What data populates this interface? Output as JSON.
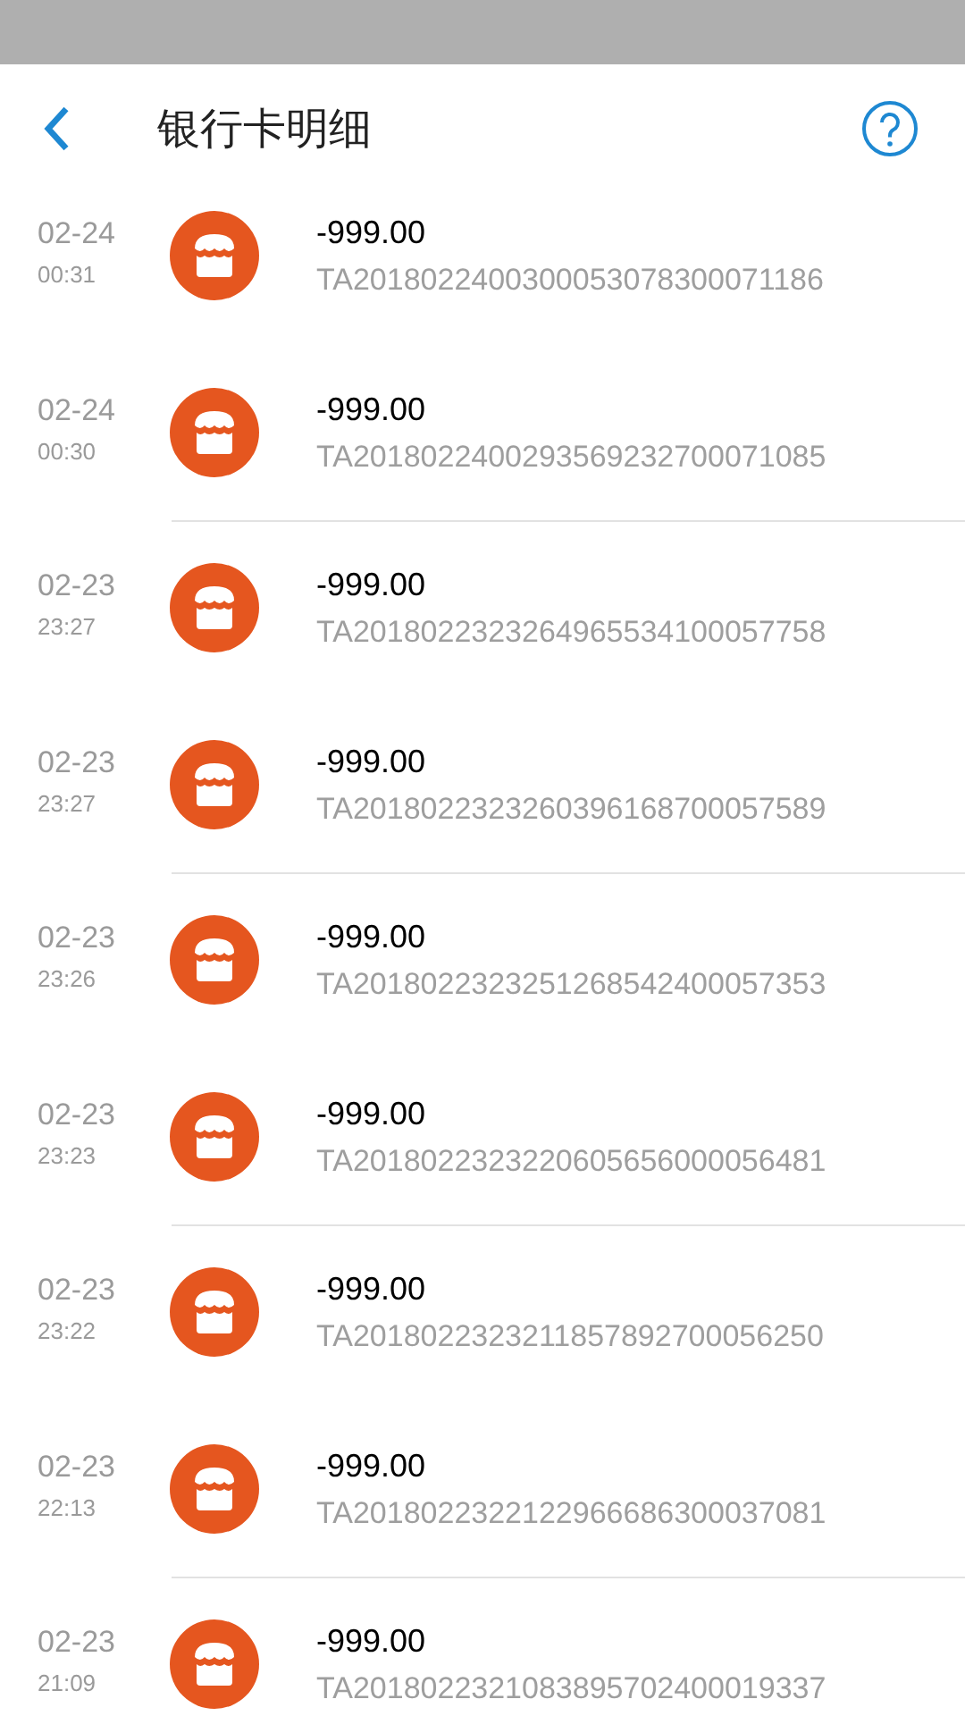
{
  "header": {
    "title": "银行卡明细"
  },
  "transactions": [
    {
      "date": "02-24",
      "time": "00:31",
      "amount": "-999.00",
      "reference": "TA2018022400300053078300071186"
    },
    {
      "date": "02-24",
      "time": "00:30",
      "amount": "-999.00",
      "reference": "TA2018022400293569232700071085"
    },
    {
      "date": "02-23",
      "time": "23:27",
      "amount": "-999.00",
      "reference": "TA2018022323264965534100057758"
    },
    {
      "date": "02-23",
      "time": "23:27",
      "amount": "-999.00",
      "reference": "TA2018022323260396168700057589"
    },
    {
      "date": "02-23",
      "time": "23:26",
      "amount": "-999.00",
      "reference": "TA2018022323251268542400057353"
    },
    {
      "date": "02-23",
      "time": "23:23",
      "amount": "-999.00",
      "reference": "TA2018022323220605656000056481"
    },
    {
      "date": "02-23",
      "time": "23:22",
      "amount": "-999.00",
      "reference": "TA2018022323211857892700056250"
    },
    {
      "date": "02-23",
      "time": "22:13",
      "amount": "-999.00",
      "reference": "TA2018022322122966686300037081"
    },
    {
      "date": "02-23",
      "time": "21:09",
      "amount": "-999.00",
      "reference": "TA2018022321083895702400019337"
    }
  ]
}
